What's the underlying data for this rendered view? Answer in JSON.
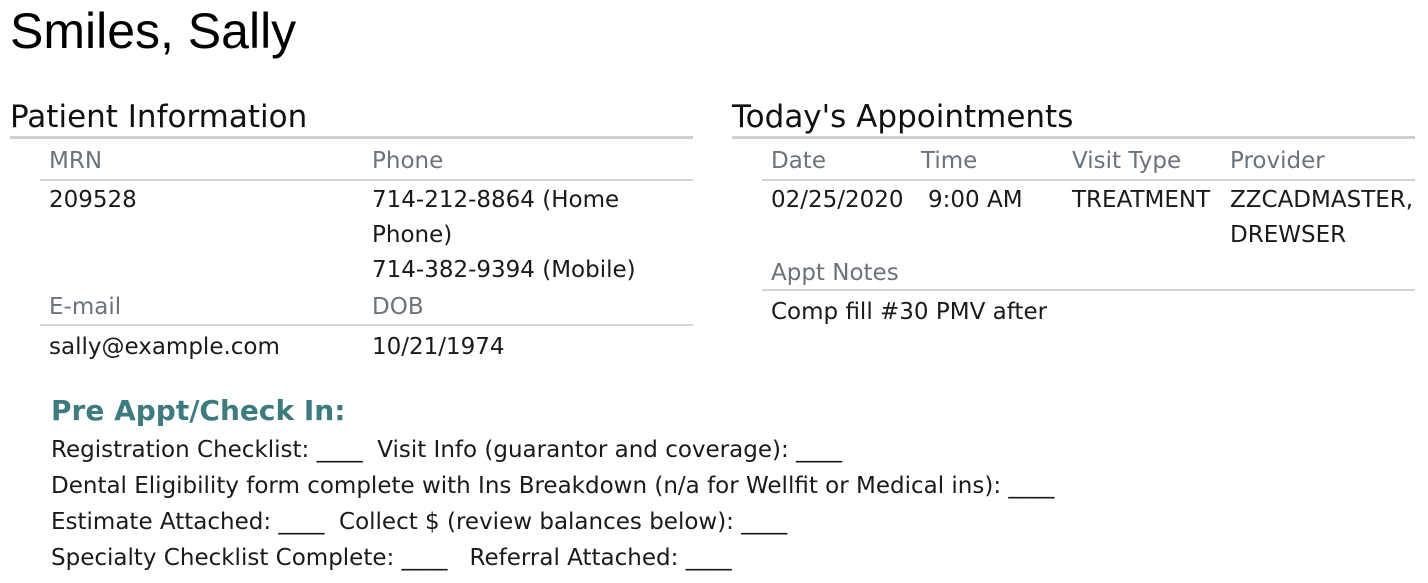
{
  "patient": {
    "name": "Smiles, Sally"
  },
  "patient_info": {
    "title": "Patient Information",
    "mrn_label": "MRN",
    "mrn": "209528",
    "phone_label": "Phone",
    "phones": [
      "714-212-8864 (Home",
      "Phone)",
      "714-382-9394 (Mobile)"
    ],
    "email_label": "E-mail",
    "email": "sally@example.com",
    "dob_label": "DOB",
    "dob": "10/21/1974"
  },
  "appointments": {
    "title": "Today's Appointments",
    "columns": [
      "Date",
      "Time",
      "Visit Type",
      "Provider"
    ],
    "row": {
      "date": "02/25/2020",
      "time": "9:00 AM",
      "visit_type": "TREATMENT",
      "provider_lines": [
        "ZZCADMASTER,",
        "DREWSER"
      ]
    },
    "notes_label": "Appt Notes",
    "notes": "Comp fill #30 PMV after"
  },
  "pre_appt": {
    "title": "Pre Appt/Check In:",
    "lines": [
      "Registration Checklist: ____  Visit Info (guarantor and coverage): ____",
      "Dental Eligibility form complete with Ins Breakdown (n/a for Wellfit or Medical ins): ____",
      "Estimate Attached: ____  Collect $ (review balances below): ____",
      "Specialty Checklist Complete: ____   Referral Attached: ____"
    ]
  },
  "colors": {
    "heading_teal": "#3e7b80",
    "label_gray": "#6a737d",
    "rule_gray": "#cfcfcf"
  }
}
